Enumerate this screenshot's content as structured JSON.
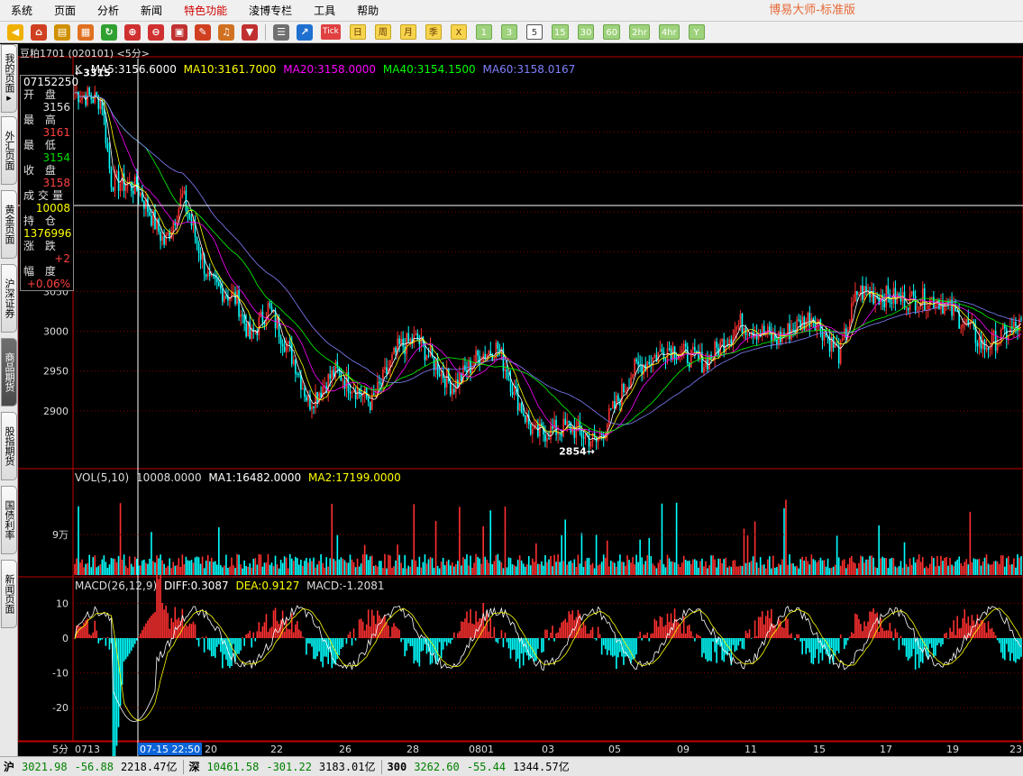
{
  "menu": {
    "items": [
      "系统",
      "页面",
      "分析",
      "新闻",
      "特色功能",
      "淩博专栏",
      "工具",
      "帮助"
    ],
    "active_index": 4,
    "app_title": "博易大师-标准版"
  },
  "toolbar": {
    "icons": [
      "back-arrow-icon",
      "home-icon",
      "book-icon",
      "layout-icon",
      "refresh-icon",
      "zoom-in-icon",
      "zoom-out-icon",
      "window-icon",
      "pencil-icon",
      "bell-icon",
      "filter-icon",
      "table-icon",
      "chart-line-icon"
    ],
    "tick_label": "Tick",
    "calendar": [
      "日",
      "周",
      "月",
      "季",
      "X"
    ],
    "periods": [
      "1",
      "3",
      "5",
      "15",
      "30",
      "60",
      "2hr",
      "4hr",
      "Y"
    ],
    "selected_period": "5"
  },
  "left_tabs": [
    {
      "label": "我的页面",
      "arrow": "▸",
      "active": false
    },
    {
      "label": "外汇页面",
      "active": false
    },
    {
      "label": "黄金页面",
      "active": false
    },
    {
      "label": "沪深证券",
      "active": false
    },
    {
      "label": "商品期货",
      "active": true
    },
    {
      "label": "股指期货",
      "active": false
    },
    {
      "label": "国债利率",
      "active": false
    },
    {
      "label": "新闻页面",
      "active": false
    }
  ],
  "stock": {
    "title": "豆粕1701 (020101) <5分>"
  },
  "indicators": {
    "k_label": "K",
    "ma5": "MA5:3156.6000",
    "ma10": "MA10:3161.7000",
    "ma20": "MA20:3158.0000",
    "ma40": "MA40:3154.1500",
    "ma60": "MA60:3158.0167",
    "colors": {
      "ma5": "#ffffff",
      "ma10": "#ffff00",
      "ma20": "#ff00ff",
      "ma40": "#00ff00",
      "ma60": "#8080ff"
    }
  },
  "data_window": {
    "time": "07152250",
    "rows": [
      {
        "label": "开 盘",
        "value": "3156",
        "color": "#e0e0e0"
      },
      {
        "label": "最 高",
        "value": "3161",
        "color": "#ff4040"
      },
      {
        "label": "最 低",
        "value": "3154",
        "color": "#00e000"
      },
      {
        "label": "收 盘",
        "value": "3158",
        "color": "#ff4040"
      },
      {
        "label": "成交量",
        "value": "10008",
        "color": "#ffff00"
      },
      {
        "label": "持 仓",
        "value": "1376996",
        "color": "#ffff00"
      },
      {
        "label": "涨 跌",
        "value": "+2",
        "color": "#ff4040"
      },
      {
        "label": "幅 度",
        "value": "+0.06%",
        "color": "#ff4040"
      }
    ]
  },
  "price_axis": {
    "labels": [
      "3050",
      "3000",
      "2950",
      "2900"
    ],
    "high_marker": "←3315",
    "low_marker": "2854→"
  },
  "volume": {
    "header": "VOL(5,10)",
    "value": "10008.0000",
    "ma1": "MA1:16482.0000",
    "ma2": "MA2:17199.0000",
    "axis_label": "9万"
  },
  "macd": {
    "header": "MACD(26,12,9)",
    "diff": "DIFF:0.3087",
    "dea": "DEA:0.9127",
    "value": "MACD:-1.2081",
    "axis_labels": [
      "10",
      "0",
      "-10",
      "-20"
    ]
  },
  "time_axis": {
    "period_label": "5分",
    "labels": [
      "0713",
      "20",
      "22",
      "26",
      "28",
      "0801",
      "03",
      "05",
      "09",
      "11",
      "15",
      "17",
      "19",
      "23"
    ],
    "cursor_label": "07-15 22:50"
  },
  "status_bar": [
    {
      "name": "沪",
      "price": "3021.98",
      "change": "-56.88",
      "amount": "2218.47亿"
    },
    {
      "name": "深",
      "price": "10461.58",
      "change": "-301.22",
      "amount": "3183.01亿"
    },
    {
      "name": "300",
      "price": "3262.60",
      "change": "-55.44",
      "amount": "1344.57亿"
    }
  ]
}
